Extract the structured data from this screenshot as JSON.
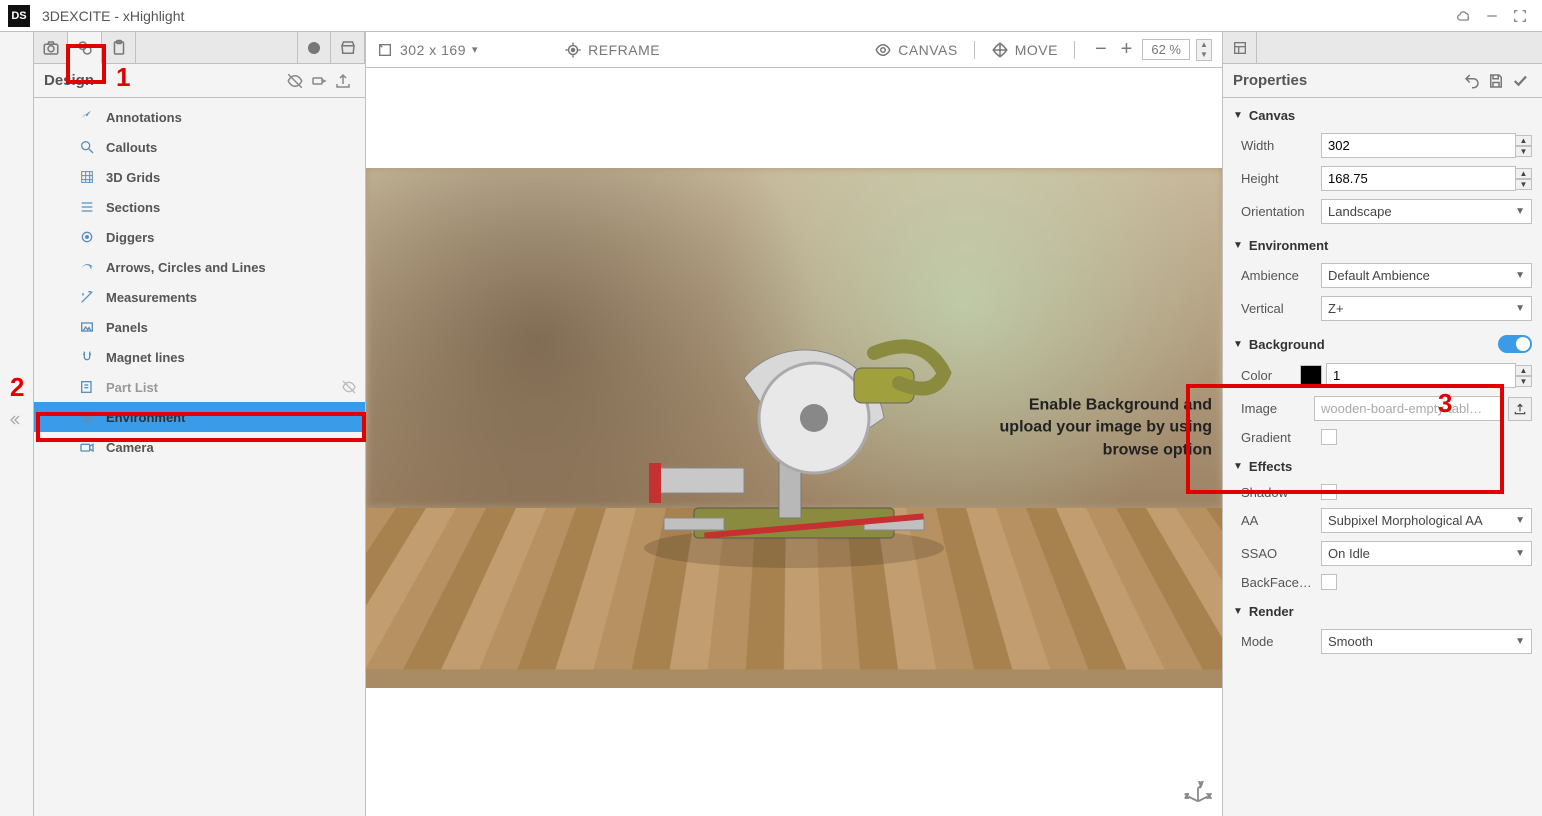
{
  "app": {
    "title": "3DEXCITE - xHighlight",
    "logo_text": "DS"
  },
  "left_panel": {
    "title": "Design",
    "items": [
      {
        "label": "Annotations",
        "icon": "annotation"
      },
      {
        "label": "Callouts",
        "icon": "callout"
      },
      {
        "label": "3D Grids",
        "icon": "grid"
      },
      {
        "label": "Sections",
        "icon": "section"
      },
      {
        "label": "Diggers",
        "icon": "digger"
      },
      {
        "label": "Arrows, Circles and Lines",
        "icon": "arrow"
      },
      {
        "label": "Measurements",
        "icon": "measure"
      },
      {
        "label": "Panels",
        "icon": "panel"
      },
      {
        "label": "Magnet lines",
        "icon": "magnet"
      },
      {
        "label": "Part List",
        "icon": "partlist",
        "dim": true,
        "end_icon": "eye-off"
      },
      {
        "label": "Environment",
        "icon": "environment",
        "selected": true
      },
      {
        "label": "Camera",
        "icon": "camera"
      }
    ]
  },
  "toolbar": {
    "dimensions": "302 x 169",
    "reframe": "REFRAME",
    "canvas": "CANVAS",
    "move": "MOVE",
    "zoom": "62 %"
  },
  "canvas": {
    "callout_line1": "Enable Background and",
    "callout_line2": "upload your image by using",
    "callout_line3": "browse option"
  },
  "properties": {
    "title": "Properties",
    "sections": {
      "canvas": {
        "title": "Canvas",
        "width_label": "Width",
        "width": "302",
        "height_label": "Height",
        "height": "168.75",
        "orientation_label": "Orientation",
        "orientation": "Landscape"
      },
      "environment": {
        "title": "Environment",
        "ambience_label": "Ambience",
        "ambience": "Default Ambience",
        "vertical_label": "Vertical",
        "vertical": "Z+"
      },
      "background": {
        "title": "Background",
        "enabled": true,
        "color_label": "Color",
        "color_hex": "#000000",
        "opacity": "1",
        "image_label": "Image",
        "image": "wooden-board-empty-tabl…",
        "gradient_label": "Gradient"
      },
      "effects": {
        "title": "Effects",
        "shadow_label": "Shadow",
        "aa_label": "AA",
        "aa": "Subpixel Morphological AA",
        "ssao_label": "SSAO",
        "ssao": "On Idle",
        "backface_label": "BackFace…"
      },
      "render": {
        "title": "Render",
        "mode_label": "Mode",
        "mode": "Smooth"
      }
    }
  },
  "marks": {
    "m1": "1",
    "m2": "2",
    "m3": "3"
  }
}
